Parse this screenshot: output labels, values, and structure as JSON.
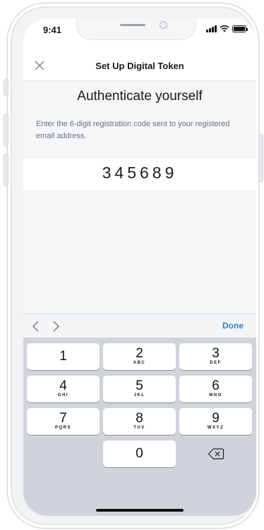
{
  "status_bar": {
    "time": "9:41"
  },
  "header": {
    "title": "Set Up Digital Token"
  },
  "main": {
    "heading": "Authenticate yourself",
    "instruction": "Enter the 6-digit registration code sent to your registered email address.",
    "code_value": "345689"
  },
  "accessory_bar": {
    "done_label": "Done"
  },
  "keypad": {
    "keys": [
      {
        "digit": "1",
        "letters": ""
      },
      {
        "digit": "2",
        "letters": "ABC"
      },
      {
        "digit": "3",
        "letters": "DEF"
      },
      {
        "digit": "4",
        "letters": "GHI"
      },
      {
        "digit": "5",
        "letters": "JKL"
      },
      {
        "digit": "6",
        "letters": "MNO"
      },
      {
        "digit": "7",
        "letters": "PQRS"
      },
      {
        "digit": "8",
        "letters": "TUV"
      },
      {
        "digit": "9",
        "letters": "WXYZ"
      },
      {
        "digit": "0",
        "letters": ""
      }
    ]
  },
  "colors": {
    "accent": "#2f80c9",
    "content_background": "#f4f6f8",
    "keypad_background": "#d0d3d9"
  },
  "icons": {
    "close": "close-icon",
    "previous": "chevron-left-icon",
    "next": "chevron-right-icon",
    "delete": "backspace-icon"
  }
}
